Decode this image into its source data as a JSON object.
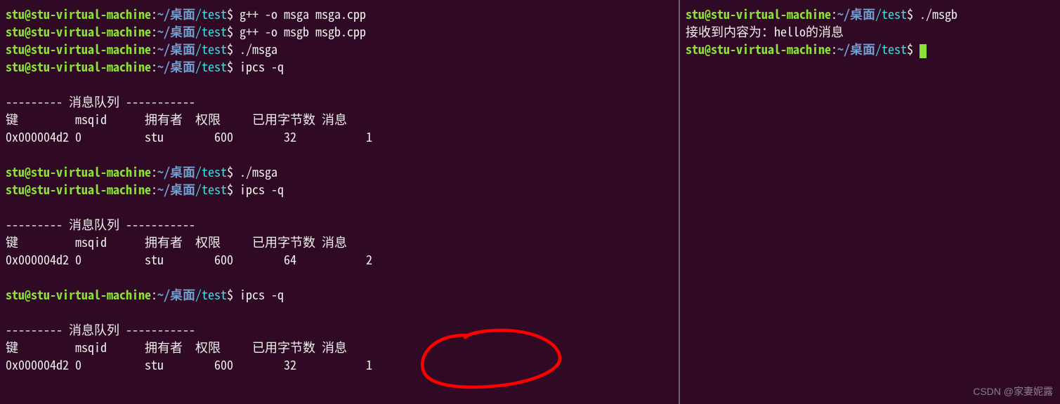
{
  "prompt": {
    "user": "stu@stu-virtual-machine",
    "colon": ":",
    "path1": "~/桌面",
    "path2": "/test",
    "symbol": "$"
  },
  "left": {
    "lines": [
      {
        "type": "prompt",
        "cmd": " g++ -o msga msga.cpp"
      },
      {
        "type": "prompt",
        "cmd": " g++ -o msgb msgb.cpp"
      },
      {
        "type": "prompt",
        "cmd": " ./msga"
      },
      {
        "type": "prompt",
        "cmd": " ipcs -q"
      },
      {
        "type": "blank"
      },
      {
        "type": "out",
        "text": "--------- 消息队列 -----------"
      },
      {
        "type": "out",
        "text": "键         msqid      拥有者  权限     已用字节数 消息      "
      },
      {
        "type": "out",
        "text": "0x000004d2 0          stu        600        32           1           "
      },
      {
        "type": "blank"
      },
      {
        "type": "prompt",
        "cmd": " ./msga"
      },
      {
        "type": "prompt",
        "cmd": " ipcs -q"
      },
      {
        "type": "blank"
      },
      {
        "type": "out",
        "text": "--------- 消息队列 -----------"
      },
      {
        "type": "out",
        "text": "键         msqid      拥有者  权限     已用字节数 消息      "
      },
      {
        "type": "out",
        "text": "0x000004d2 0          stu        600        64           2           "
      },
      {
        "type": "blank"
      },
      {
        "type": "prompt",
        "cmd": " ipcs -q"
      },
      {
        "type": "blank"
      },
      {
        "type": "out",
        "text": "--------- 消息队列 -----------"
      },
      {
        "type": "out",
        "text": "键         msqid      拥有者  权限     已用字节数 消息      "
      },
      {
        "type": "out",
        "text": "0x000004d2 0          stu        600        32           1           "
      }
    ]
  },
  "right": {
    "lines": [
      {
        "type": "prompt",
        "cmd": " ./msgb"
      },
      {
        "type": "out",
        "text": "接收到内容为：hello的消息"
      },
      {
        "type": "prompt-cursor",
        "cmd": " "
      }
    ]
  },
  "watermark": "CSDN @家妻妮露"
}
